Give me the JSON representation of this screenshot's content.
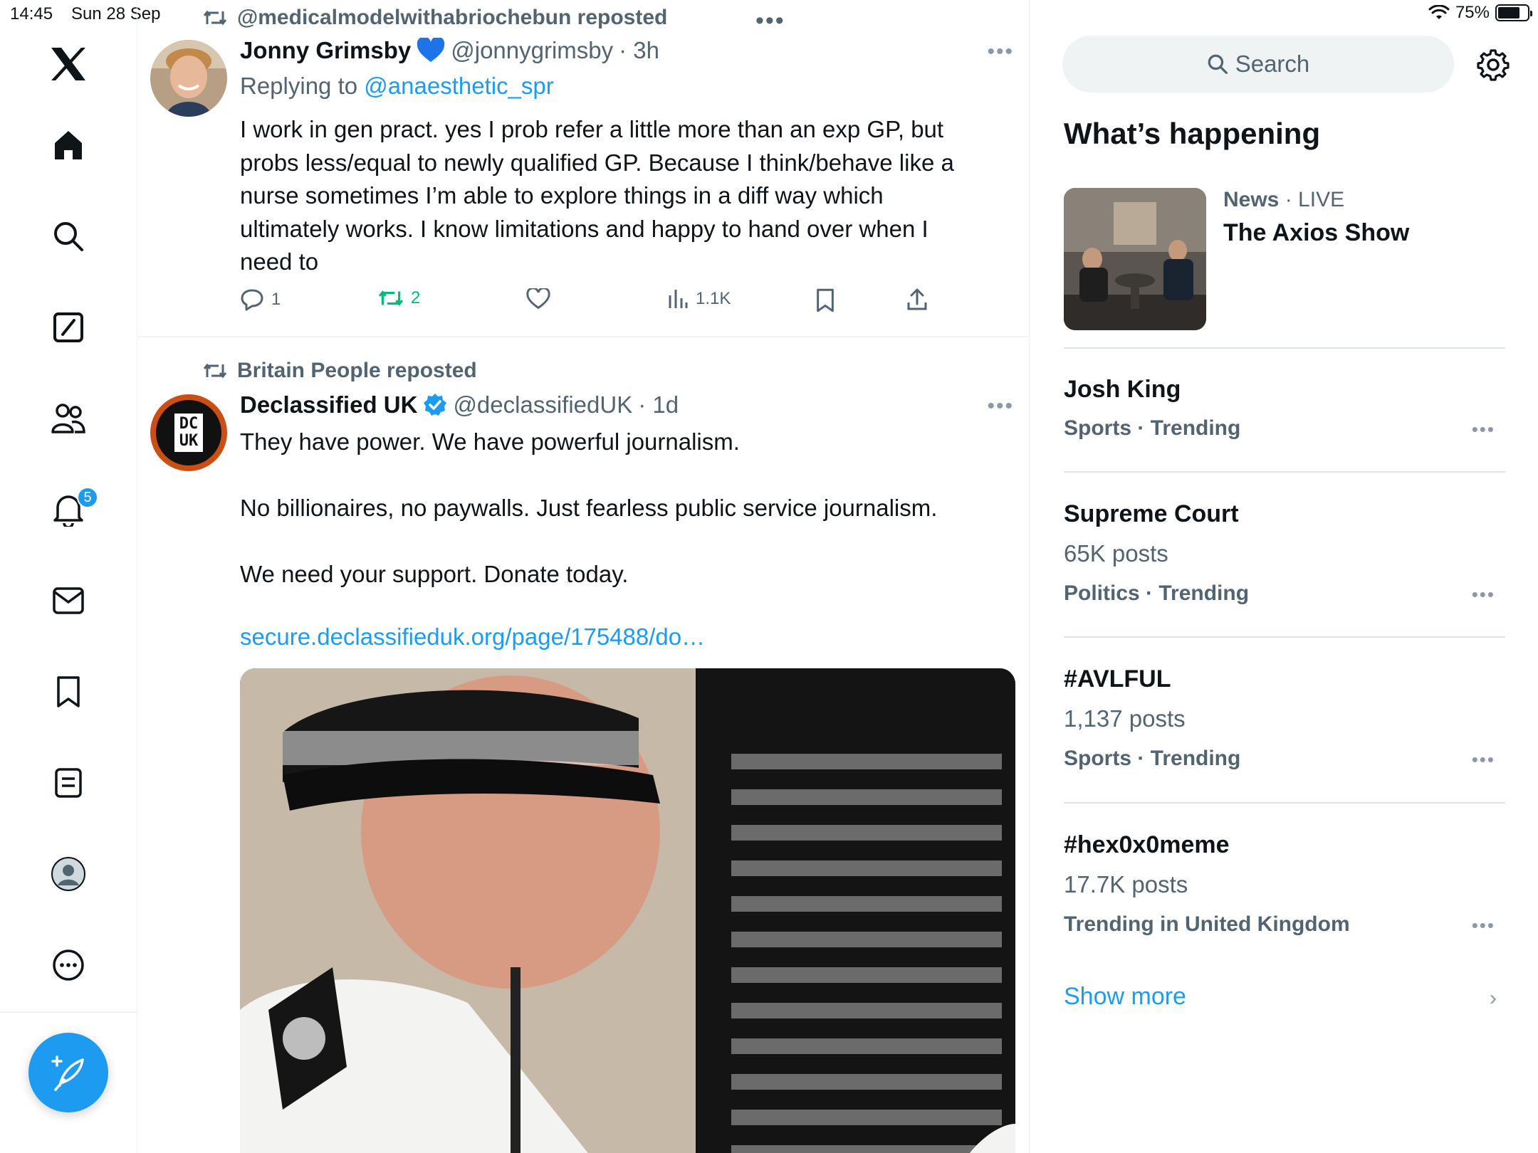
{
  "status_bar": {
    "time": "14:45",
    "date": "Sun 28 Sep",
    "battery": "75%"
  },
  "nav": {
    "notifications_badge": "5"
  },
  "feed": {
    "tweets": [
      {
        "repost_by": "@medicalmodelwithabriochebun reposted",
        "name": "Jonny Grimsby",
        "handle": "@jonnygrimsby",
        "time": "· 3h",
        "replying_prefix": "Replying to",
        "replying_to": "@anaesthetic_spr",
        "text": "I work in gen pract. yes I prob refer a little more than an exp GP, but probs less/equal to newly qualified GP. Because I think/behave like a nurse sometimes I’m able to explore things in a diff way which ultimately works. I know limitations and happy to hand over when I need to",
        "replies": "1",
        "reposts": "2",
        "views": "1.1K"
      },
      {
        "repost_by": "Britain People reposted",
        "name": "Declassified UK",
        "handle": "@declassifiedUK",
        "time": "· 1d",
        "avatar_text_1": "DC",
        "avatar_text_2": "UK",
        "text": "They have power. We have powerful journalism.\n\nNo billionaires, no paywalls. Just fearless public service journalism.\n\nWe need your support. Donate today.",
        "link": "secure.declassifieduk.org/page/175488/do…"
      }
    ]
  },
  "sidebar": {
    "search_placeholder": "Search",
    "section_title": "What’s happening",
    "news": {
      "category": "News",
      "live": "· LIVE",
      "title": "The Axios Show"
    },
    "trends": [
      {
        "title": "Josh King",
        "count": "",
        "meta": "Sports · Trending"
      },
      {
        "title": "Supreme Court",
        "count": "65K posts",
        "meta": "Politics · Trending"
      },
      {
        "title": "#AVLFUL",
        "count": "1,137 posts",
        "meta": "Sports · Trending"
      },
      {
        "title": "#hex0x0meme",
        "count": "17.7K posts",
        "meta": "Trending in United Kingdom"
      }
    ],
    "show_more": "Show more"
  },
  "colors": {
    "accent": "#1d9bf0",
    "repost_green": "#00ba7c",
    "secondary_text": "#536471"
  }
}
